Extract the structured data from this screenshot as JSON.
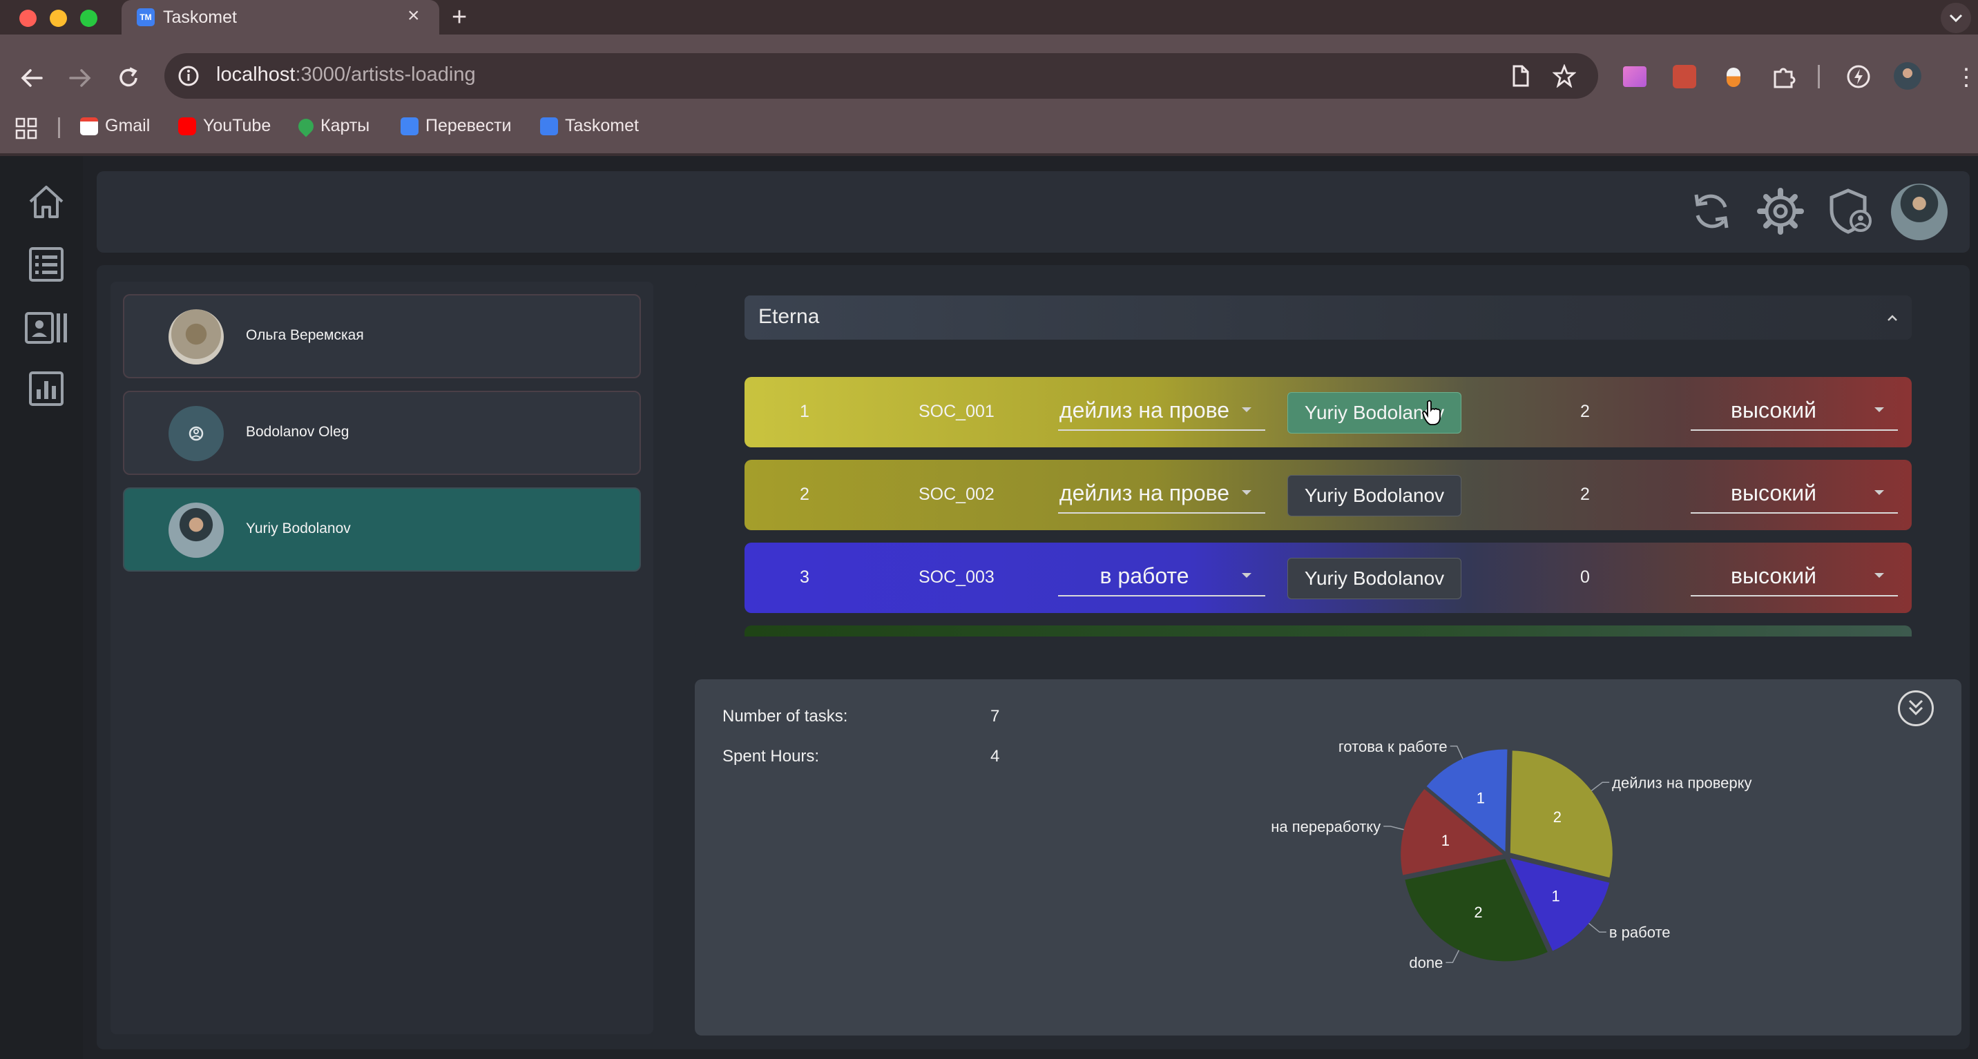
{
  "browser": {
    "tab_title": "Taskomet",
    "tab_favicon_text": "TM",
    "url_host": "localhost",
    "url_path": ":3000/artists-loading",
    "bookmarks": [
      {
        "label": "Gmail",
        "icon": "gmail-icon",
        "color": "#ea4335"
      },
      {
        "label": "YouTube",
        "icon": "youtube-icon",
        "color": "#ff0000"
      },
      {
        "label": "Карты",
        "icon": "maps-icon",
        "color": "#34a853"
      },
      {
        "label": "Перевести",
        "icon": "translate-icon",
        "color": "#4285f4"
      },
      {
        "label": "Taskomet",
        "icon": "taskomet-icon",
        "color": "#3f7ff0"
      }
    ]
  },
  "sidebar": {
    "items": [
      "home-icon",
      "list-icon",
      "artists-icon",
      "chart-icon"
    ]
  },
  "artists": [
    {
      "name": "Ольга Веремская",
      "selected": false
    },
    {
      "name": "Bodolanov Oleg",
      "selected": false
    },
    {
      "name": "Yuriy Bodolanov",
      "selected": true
    }
  ],
  "project": {
    "title": "Eterna",
    "tasks": [
      {
        "num": "1",
        "code": "SOC_001",
        "status": "дейлиз на прове",
        "assignee": "Yuriy Bodolanov",
        "hours": "2",
        "priority": "высокий"
      },
      {
        "num": "2",
        "code": "SOC_002",
        "status": "дейлиз на прове",
        "assignee": "Yuriy Bodolanov",
        "hours": "2",
        "priority": "высокий"
      },
      {
        "num": "3",
        "code": "SOC_003",
        "status": "в работе",
        "assignee": "Yuriy Bodolanov",
        "hours": "0",
        "priority": "высокий"
      }
    ]
  },
  "stats": {
    "tasks_label": "Number of tasks:",
    "tasks_value": "7",
    "hours_label": "Spent Hours:",
    "hours_value": "4"
  },
  "chart_data": {
    "type": "pie",
    "slices": [
      {
        "label": "дейлиз на проверку",
        "value": 2,
        "color": "#9c9a33"
      },
      {
        "label": "в работе",
        "value": 1,
        "color": "#3b30c9"
      },
      {
        "label": "done",
        "value": 2,
        "color": "#234a17"
      },
      {
        "label": "на переработку",
        "value": 1,
        "color": "#8e3434"
      },
      {
        "label": "готова к работе",
        "value": 1,
        "color": "#3c5fd3"
      }
    ]
  }
}
